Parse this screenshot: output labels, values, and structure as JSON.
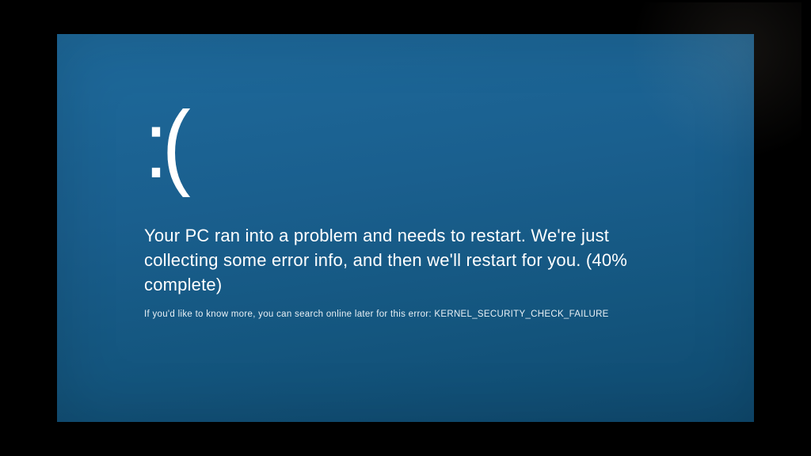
{
  "bsod": {
    "emoticon": ":(",
    "main_message": "Your PC ran into a problem and needs to restart. We're just collecting some error info, and then we'll restart for you. (40% complete)",
    "sub_message_prefix": "If you'd like to know more, you can search online later for this error: ",
    "error_code": "KERNEL_SECURITY_CHECK_FAILURE",
    "progress_percent": 40,
    "background_color": "#1a6a99",
    "text_color": "#ffffff"
  }
}
